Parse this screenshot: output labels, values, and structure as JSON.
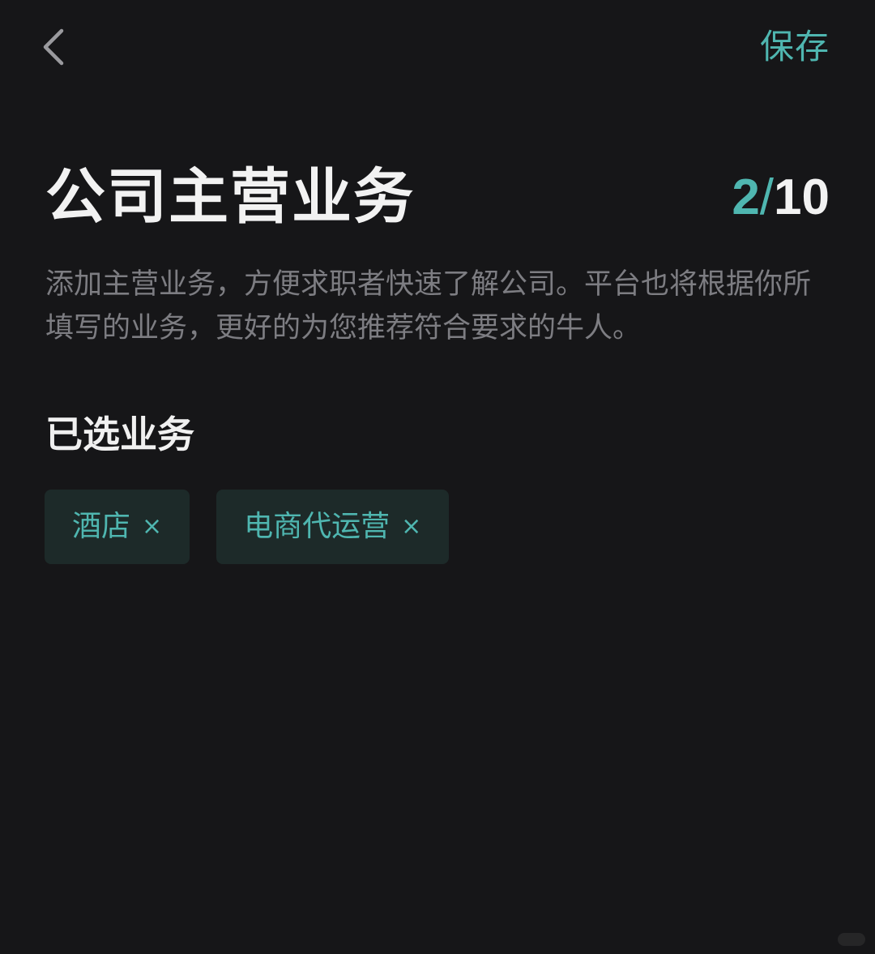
{
  "header": {
    "back_icon": "chevron-left-icon",
    "save_label": "保存"
  },
  "page": {
    "title": "公司主营业务",
    "counter": {
      "current": "2",
      "separator": "/",
      "total": "10"
    },
    "description": "添加主营业务，方便求职者快速了解公司。平台也将根据你所填写的业务，更好的为您推荐符合要求的牛人。"
  },
  "selected": {
    "section_title": "已选业务",
    "tags": [
      {
        "label": "酒店",
        "remove_icon": "×"
      },
      {
        "label": "电商代运营",
        "remove_icon": "×"
      }
    ]
  },
  "colors": {
    "background": "#161618",
    "accent": "#4fb6b0",
    "tag_background": "#1d2a29",
    "muted_text": "#7d7d82"
  }
}
